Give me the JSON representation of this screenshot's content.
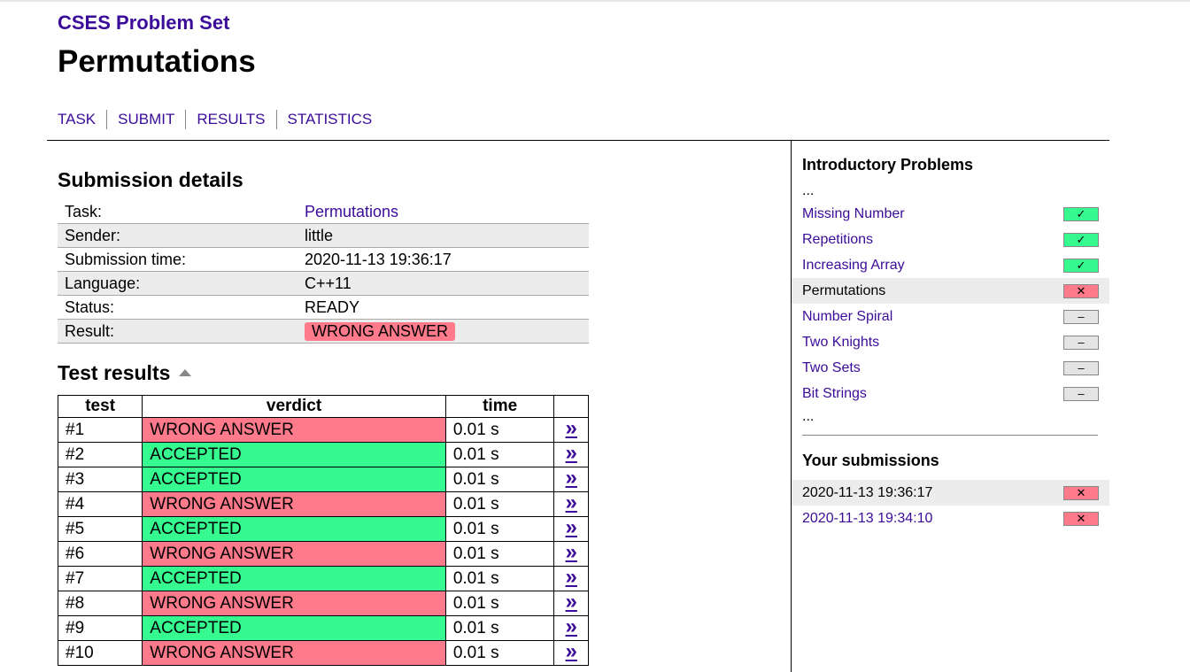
{
  "site_title": "CSES Problem Set",
  "page_title": "Permutations",
  "nav": [
    "TASK",
    "SUBMIT",
    "RESULTS",
    "STATISTICS"
  ],
  "submission": {
    "heading": "Submission details",
    "rows": [
      {
        "label": "Task:",
        "value": "Permutations"
      },
      {
        "label": "Sender:",
        "value": "little"
      },
      {
        "label": "Submission time:",
        "value": "2020-11-13 19:36:17"
      },
      {
        "label": "Language:",
        "value": "C++11"
      },
      {
        "label": "Status:",
        "value": "READY"
      },
      {
        "label": "Result:",
        "value": "WRONG ANSWER"
      }
    ]
  },
  "tests": {
    "heading": "Test results",
    "columns": [
      "test",
      "verdict",
      "time"
    ],
    "link_glyph": "»",
    "rows": [
      {
        "test": "#1",
        "verdict": "WRONG ANSWER",
        "time": "0.01 s"
      },
      {
        "test": "#2",
        "verdict": "ACCEPTED",
        "time": "0.01 s"
      },
      {
        "test": "#3",
        "verdict": "ACCEPTED",
        "time": "0.01 s"
      },
      {
        "test": "#4",
        "verdict": "WRONG ANSWER",
        "time": "0.01 s"
      },
      {
        "test": "#5",
        "verdict": "ACCEPTED",
        "time": "0.01 s"
      },
      {
        "test": "#6",
        "verdict": "WRONG ANSWER",
        "time": "0.01 s"
      },
      {
        "test": "#7",
        "verdict": "ACCEPTED",
        "time": "0.01 s"
      },
      {
        "test": "#8",
        "verdict": "WRONG ANSWER",
        "time": "0.01 s"
      },
      {
        "test": "#9",
        "verdict": "ACCEPTED",
        "time": "0.01 s"
      },
      {
        "test": "#10",
        "verdict": "WRONG ANSWER",
        "time": "0.01 s"
      }
    ]
  },
  "sidebar": {
    "section_title": "Introductory Problems",
    "ellipsis": "...",
    "problems": [
      {
        "name": "Missing Number",
        "status": "ok",
        "mark": "✓"
      },
      {
        "name": "Repetitions",
        "status": "ok",
        "mark": "✓"
      },
      {
        "name": "Increasing Array",
        "status": "ok",
        "mark": "✓"
      },
      {
        "name": "Permutations",
        "status": "bad",
        "mark": "✕",
        "current": true
      },
      {
        "name": "Number Spiral",
        "status": "none",
        "mark": "–"
      },
      {
        "name": "Two Knights",
        "status": "none",
        "mark": "–"
      },
      {
        "name": "Two Sets",
        "status": "none",
        "mark": "–"
      },
      {
        "name": "Bit Strings",
        "status": "none",
        "mark": "–"
      }
    ],
    "submissions_title": "Your submissions",
    "submissions": [
      {
        "time": "2020-11-13 19:36:17",
        "status": "bad",
        "mark": "✕",
        "current": true
      },
      {
        "time": "2020-11-13 19:34:10",
        "status": "bad",
        "mark": "✕"
      }
    ]
  },
  "colors": {
    "link": "#3b0b99",
    "accepted": "#36fa8f",
    "wrong": "#ff7a8a",
    "row_alt": "#ececec"
  }
}
